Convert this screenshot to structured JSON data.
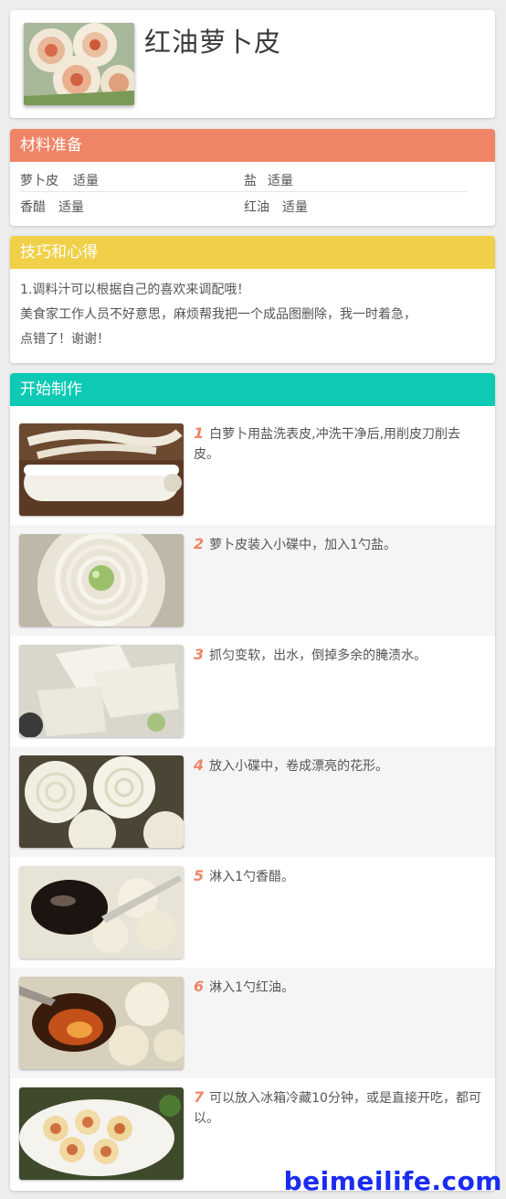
{
  "recipe": {
    "title": "红油萝卜皮"
  },
  "ingredients": {
    "header": "材料准备",
    "items": [
      {
        "name": "萝卜皮",
        "qty": "适量"
      },
      {
        "name": "盐",
        "qty": "适量"
      },
      {
        "name": "香醋",
        "qty": "适量"
      },
      {
        "name": "红油",
        "qty": "适量"
      }
    ]
  },
  "tips": {
    "header": "技巧和心得",
    "lines": [
      "1.调料汁可以根据自己的喜欢来调配哦！",
      "美食家工作人员不好意思，麻烦帮我把一个成品图删除，我一时着急，",
      "点错了！谢谢！"
    ]
  },
  "steps": {
    "header": "开始制作",
    "items": [
      {
        "num": "1",
        "text": "白萝卜用盐洗表皮,冲洗干净后,用削皮刀削去皮。"
      },
      {
        "num": "2",
        "text": "萝卜皮装入小碟中，加入1勺盐。"
      },
      {
        "num": "3",
        "text": "抓匀变软，出水，倒掉多余的腌渍水。"
      },
      {
        "num": "4",
        "text": "放入小碟中，卷成漂亮的花形。"
      },
      {
        "num": "5",
        "text": "淋入1勺香醋。"
      },
      {
        "num": "6",
        "text": "淋入1勺红油。"
      },
      {
        "num": "7",
        "text": "可以放入冰箱冷藏10分钟，或是直接开吃，都可以。"
      }
    ]
  },
  "watermark": "beimeilife.com"
}
